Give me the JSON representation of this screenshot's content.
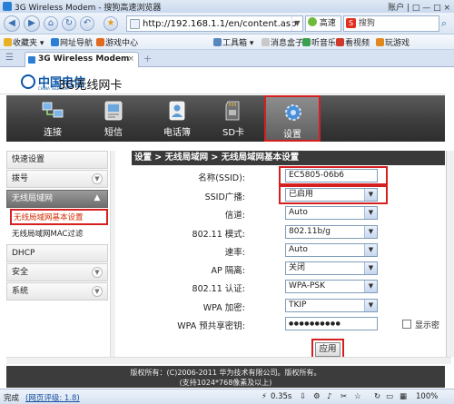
{
  "browser": {
    "window_title": "3G Wireless Modem - 搜狗高速浏览器",
    "window_controls": "账户 | □  —  □  ×",
    "url": "http://192.168.1.1/en/content.asp",
    "fast_mode_label": "高速",
    "search_placeholder": "搜狗",
    "favorites": [
      {
        "label": "收藏夹 ▾",
        "color": "#e8b023"
      },
      {
        "label": "网址导航",
        "color": "#2a7fd4"
      },
      {
        "label": "游戏中心",
        "color": "#e06a1e"
      }
    ],
    "tools": [
      {
        "label": "工具箱 ▾",
        "color": "#5a86c0"
      },
      {
        "label": "消息盒子",
        "color": "#c9c9c9"
      },
      {
        "label": "听音乐",
        "color": "#3aa050"
      },
      {
        "label": "看视频",
        "color": "#d03a2a"
      },
      {
        "label": "玩游戏",
        "color": "#e08a1e"
      }
    ],
    "tab_title": "3G Wireless Modem",
    "status": {
      "left_label": "完成",
      "link_label": "(网页评级: 1.8)",
      "time": "0.35s",
      "zoom": "100%"
    }
  },
  "page": {
    "logo_cn": "中国电信",
    "logo_en": "CHINA TELECOM",
    "logo_suffix": "3G无线网卡",
    "menu": [
      {
        "label": "连接",
        "icon": "network-connect-icon"
      },
      {
        "label": "短信",
        "icon": "sms-icon"
      },
      {
        "label": "电话簿",
        "icon": "phonebook-icon"
      },
      {
        "label": "SD卡",
        "icon": "sd-card-icon"
      },
      {
        "label": "设置",
        "icon": "gear-icon"
      }
    ],
    "sidebar": [
      {
        "label": "快速设置"
      },
      {
        "label": "拨号"
      },
      {
        "label": "无线局域网"
      },
      {
        "label": "无线局域网基本设置"
      },
      {
        "label": "无线局域网MAC过滤"
      },
      {
        "label": "DHCP"
      },
      {
        "label": "安全"
      },
      {
        "label": "系统"
      }
    ],
    "content_title": "设置 > 无线局域网 > 无线局域网基本设置",
    "form": [
      {
        "label": "名称(SSID):",
        "value": "EC5805-06b6"
      },
      {
        "label": "SSID广播:",
        "value": "已启用"
      },
      {
        "label": "信道:",
        "value": "Auto"
      },
      {
        "label": "802.11 模式:",
        "value": "802.11b/g"
      },
      {
        "label": "速率:",
        "value": "Auto"
      },
      {
        "label": "AP 隔离:",
        "value": "关闭"
      },
      {
        "label": "802.11 认证:",
        "value": "WPA-PSK"
      },
      {
        "label": "WPA 加密:",
        "value": "TKIP"
      },
      {
        "label": "WPA 预共享密钥:",
        "value": "●●●●●●●●●●"
      }
    ],
    "show_password_label": "显示密",
    "apply_label": "应用",
    "footer_line1": "版权所有：(C)2006-2011 华为技术有限公司。版权所有。",
    "footer_line2": "(支持1024*768像素及以上)"
  },
  "colors": {
    "highlight": "#d62020",
    "menu_bg": "#3b3b3b",
    "brand_blue": "#0b55a6"
  }
}
